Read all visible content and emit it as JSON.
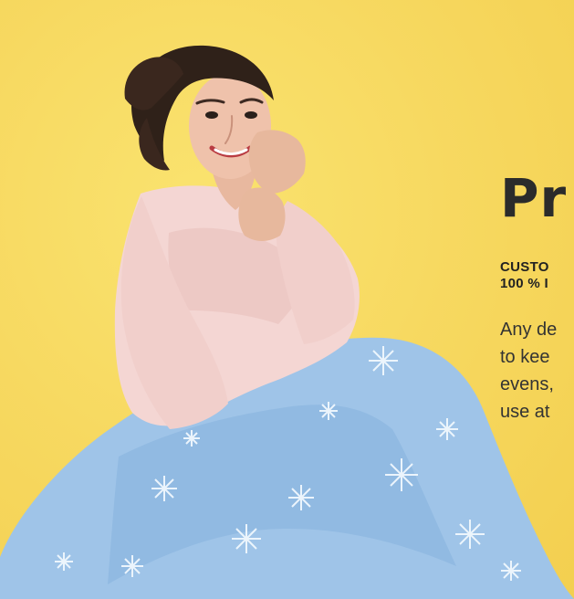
{
  "hero": {
    "background_color": "#f7d961",
    "blanket_color": "#9fc4e8",
    "sweater_color": "#f4d6d3",
    "hair_color": "#2f2119"
  },
  "text": {
    "title": "Pr",
    "eyebrow_line_1": "CUSTO",
    "eyebrow_line_2": "100 % I",
    "body_line_1": "Any de",
    "body_line_2": "to kee",
    "body_line_3": "evens,",
    "body_line_4": "use at"
  }
}
